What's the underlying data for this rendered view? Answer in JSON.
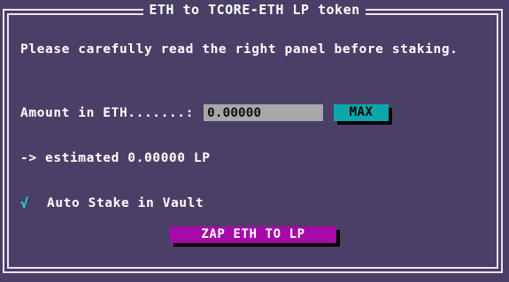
{
  "title": "ETH to TCORE-ETH LP token",
  "warning": "Please carefully read the right panel before staking.",
  "amount": {
    "label": "Amount in ETH.......:",
    "value": "0.00000"
  },
  "max_button": "MAX",
  "estimate": "-> estimated 0.00000 LP",
  "auto_stake": {
    "checked": true,
    "check_glyph": "√",
    "label": "Auto Stake in Vault"
  },
  "zap_button": "ZAP ETH TO LP",
  "colors": {
    "background": "#4a3f66",
    "border": "#e9e4f2",
    "max_button": "#0aa8ab",
    "zap_button": "#a60aa8",
    "check": "#22d6d9",
    "input": "#a8a8a8"
  }
}
